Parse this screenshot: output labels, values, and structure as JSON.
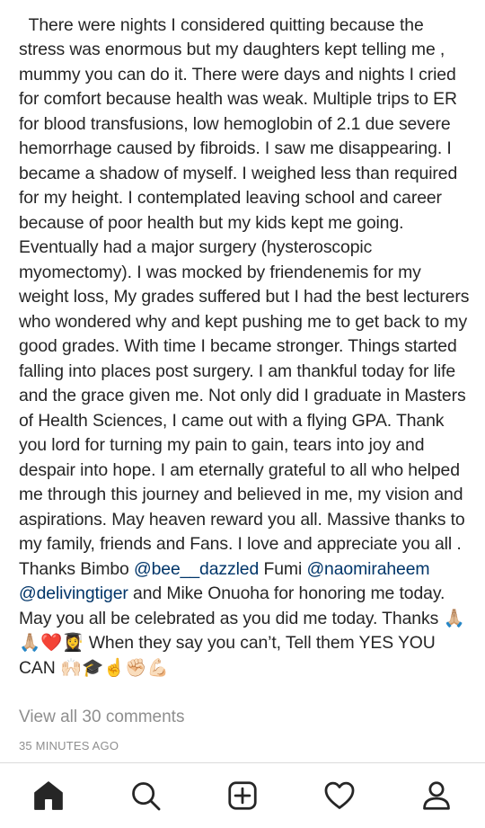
{
  "post": {
    "caption_segments": [
      {
        "text": "There were nights I considered quitting because the stress was enormous but my daughters kept telling me , mummy you can do it. There were days and nights I cried for comfort because health was weak. Multiple trips to ER for blood transfusions, low hemoglobin of 2.1 due severe hemorrhage caused by fibroids. I saw me disappearing. I became a shadow of myself. I weighed less than required for my height. I contemplated leaving school and career because of poor health but my kids kept me going. Eventually had a major surgery (hysteroscopic myomectomy). I was mocked by friendenemis for my weight loss, My grades suffered but I had the best lecturers who wondered why and kept pushing me to get back to my good grades. With time I became stronger. Things started falling into places post surgery. I am thankful today for life and the grace given me. Not only did I graduate in Masters of Health Sciences, I came out with a flying GPA. Thank you lord for turning my pain to gain, tears into joy and despair into hope. I am eternally grateful to all who helped me through this journey and believed in me, my vision and aspirations. May heaven reward you all. Massive thanks to my family, friends and Fans. I love and appreciate you all . Thanks Bimbo ",
        "type": "text"
      },
      {
        "text": "@bee__dazzled",
        "type": "mention"
      },
      {
        "text": " Fumi ",
        "type": "text"
      },
      {
        "text": "@naomiraheem",
        "type": "mention"
      },
      {
        "text": " ",
        "type": "text"
      },
      {
        "text": "@delivingtiger",
        "type": "mention"
      },
      {
        "text": " and Mike Onuoha for honoring me today. May you all be celebrated as you did me today. Thanks ",
        "type": "text"
      },
      {
        "text": "🙏🏼🙏🏼❤️👩‍🎓",
        "type": "emoji"
      },
      {
        "text": " When they say you can’t, Tell them YES YOU CAN ",
        "type": "text"
      },
      {
        "text": "🙌🏻🎓☝️✊🏻💪🏻",
        "type": "emoji"
      }
    ],
    "view_all_comments": "View all 30 comments",
    "timestamp": "35 MINUTES AGO"
  },
  "tabbar": {
    "items": [
      {
        "name": "home",
        "icon": "home-icon",
        "active": true
      },
      {
        "name": "search",
        "icon": "search-icon",
        "active": false
      },
      {
        "name": "new-post",
        "icon": "add-post-icon",
        "active": false
      },
      {
        "name": "activity",
        "icon": "heart-icon",
        "active": false
      },
      {
        "name": "profile",
        "icon": "profile-icon",
        "active": false
      }
    ]
  },
  "colors": {
    "text": "#262626",
    "mention": "#003569",
    "muted": "#8e8e8e",
    "divider": "#dbdbdb"
  }
}
